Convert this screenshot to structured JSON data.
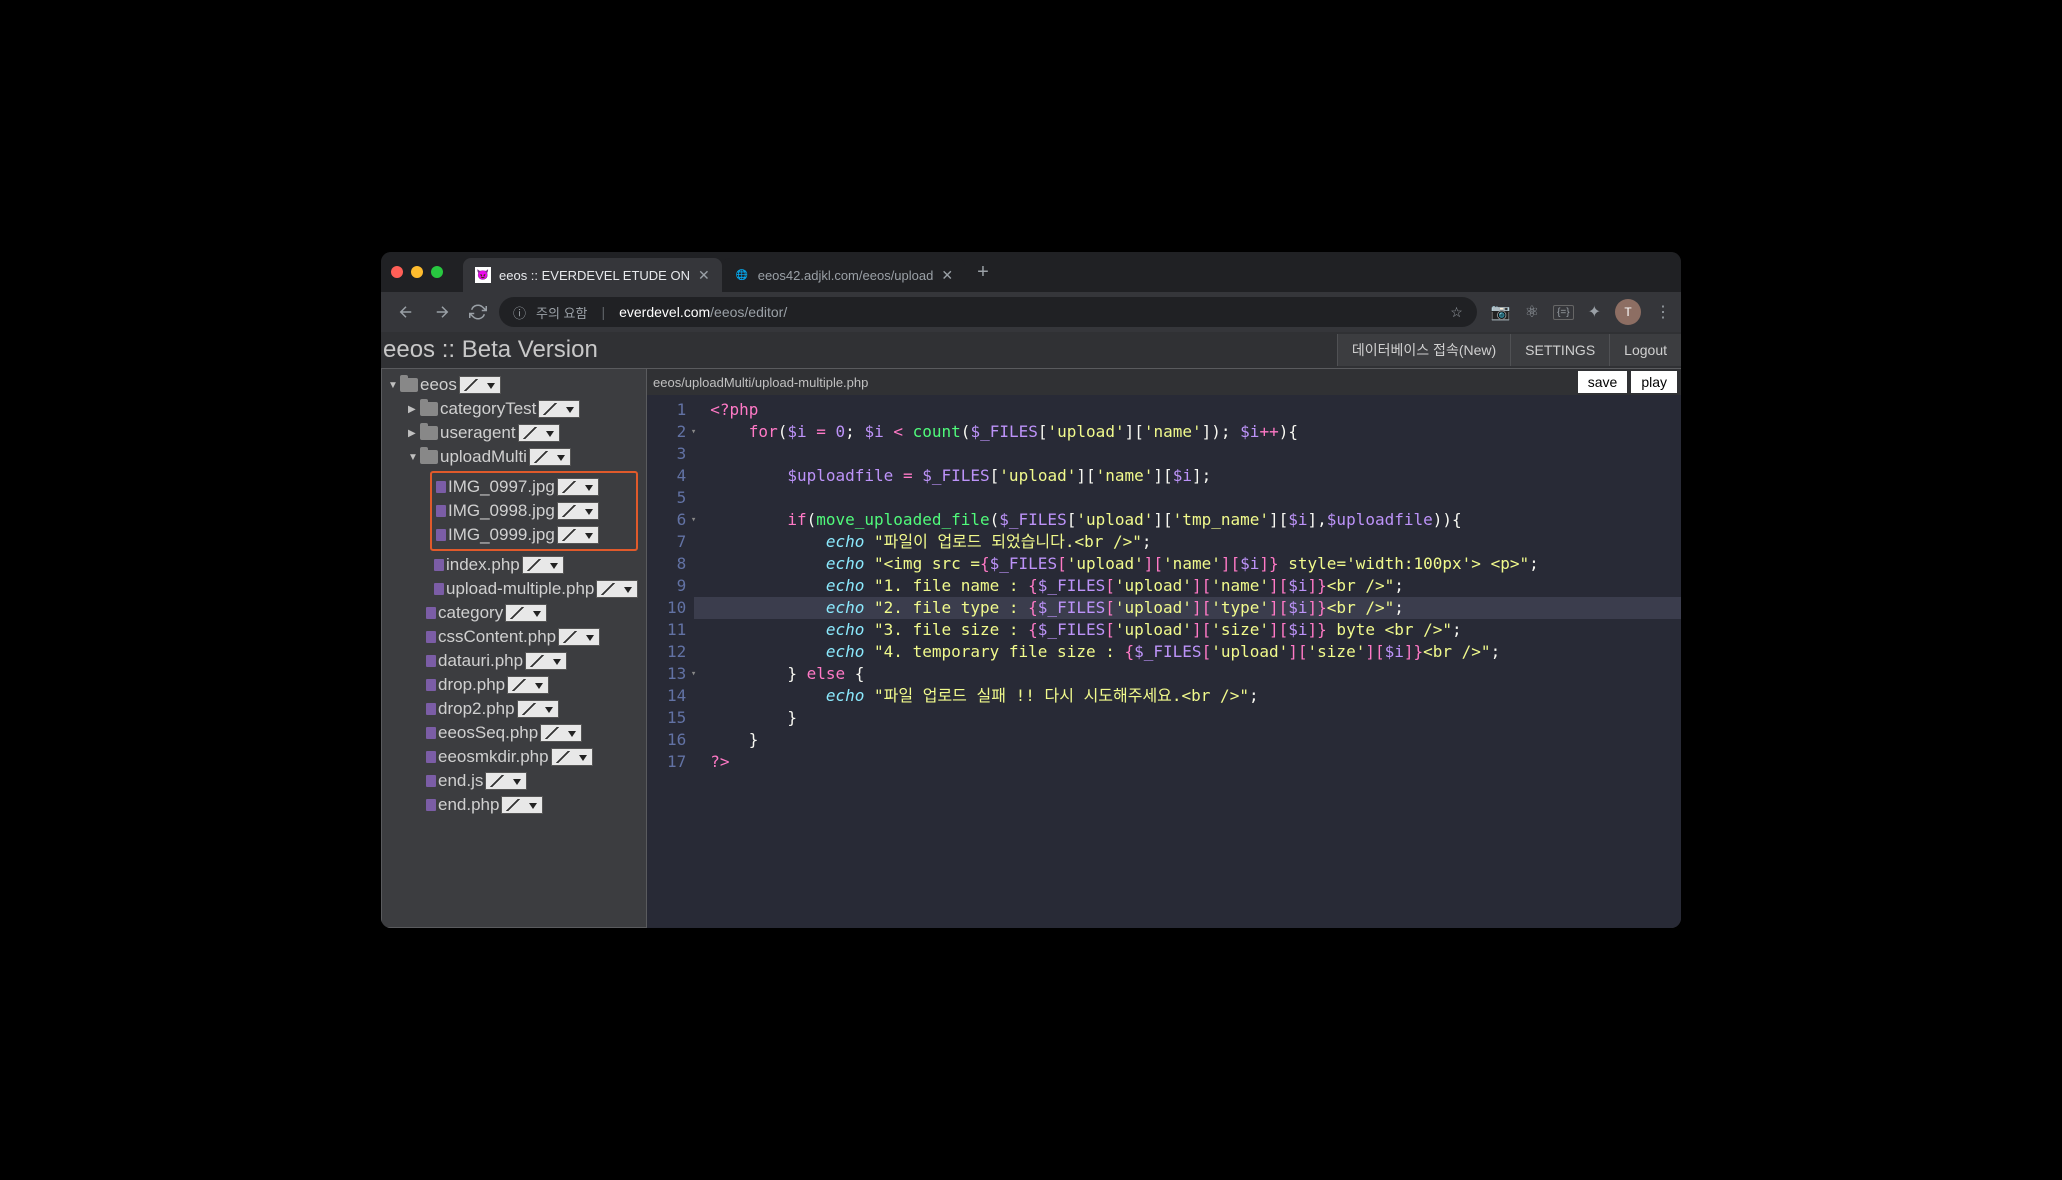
{
  "browser": {
    "tabs": [
      {
        "title": "eeos :: EVERDEVEL ETUDE ON",
        "favicon": "😈",
        "active": true
      },
      {
        "title": "eeos42.adjkl.com/eeos/upload",
        "favicon": "globe",
        "active": false
      }
    ],
    "url": {
      "warning": "주의 요함",
      "host": "everdevel.com",
      "path": "/eeos/editor/"
    },
    "avatar_letter": "T"
  },
  "app": {
    "title": "eeos :: Beta Version",
    "header_buttons": {
      "db": "데이터베이스 접속(New)",
      "settings": "SETTINGS",
      "logout": "Logout"
    },
    "breadcrumb": "eeos/uploadMulti/upload-multiple.php",
    "action_buttons": {
      "save": "save",
      "play": "play"
    }
  },
  "tree": {
    "root": {
      "name": "eeos",
      "arrow": "▼"
    },
    "folders": [
      {
        "name": "categoryTest",
        "arrow": "▶",
        "indent": 1
      },
      {
        "name": "useragent",
        "arrow": "▶",
        "indent": 1
      },
      {
        "name": "uploadMulti",
        "arrow": "▼",
        "indent": 1
      }
    ],
    "highlighted_files": [
      "IMG_0997.jpg",
      "IMG_0998.jpg",
      "IMG_0999.jpg"
    ],
    "upload_multi_files": [
      "index.php",
      "upload-multiple.php"
    ],
    "root_files": [
      "category",
      "cssContent.php",
      "datauri.php",
      "drop.php",
      "drop2.php",
      "eeosSeq.php",
      "eeosmkdir.php",
      "end.js",
      "end.php"
    ]
  },
  "code": {
    "lines": [
      {
        "n": 1,
        "fold": "",
        "tokens": [
          [
            "c-php",
            "<?php"
          ]
        ]
      },
      {
        "n": 2,
        "fold": "▾",
        "tokens": [
          [
            "",
            "    "
          ],
          [
            "c-kw",
            "for"
          ],
          [
            "c-punc",
            "("
          ],
          [
            "c-varn",
            "$i"
          ],
          [
            "c-punc",
            " "
          ],
          [
            "c-op",
            "="
          ],
          [
            "c-punc",
            " "
          ],
          [
            "c-num",
            "0"
          ],
          [
            "c-punc",
            "; "
          ],
          [
            "c-varn",
            "$i"
          ],
          [
            "c-punc",
            " "
          ],
          [
            "c-op",
            "<"
          ],
          [
            "c-punc",
            " "
          ],
          [
            "c-func",
            "count"
          ],
          [
            "c-punc",
            "("
          ],
          [
            "c-varn",
            "$_FILES"
          ],
          [
            "c-punc",
            "["
          ],
          [
            "c-str",
            "'upload'"
          ],
          [
            "c-punc",
            "]["
          ],
          [
            "c-str",
            "'name'"
          ],
          [
            "c-punc",
            "]); "
          ],
          [
            "c-varn",
            "$i"
          ],
          [
            "c-op",
            "++"
          ],
          [
            "c-punc",
            ")"
          ],
          [
            "c-punc",
            "{"
          ]
        ]
      },
      {
        "n": 3,
        "fold": "",
        "tokens": [
          [
            "",
            ""
          ]
        ]
      },
      {
        "n": 4,
        "fold": "",
        "tokens": [
          [
            "",
            "        "
          ],
          [
            "c-varn",
            "$uploadfile"
          ],
          [
            "c-punc",
            " "
          ],
          [
            "c-op",
            "="
          ],
          [
            "c-punc",
            " "
          ],
          [
            "c-varn",
            "$_FILES"
          ],
          [
            "c-punc",
            "["
          ],
          [
            "c-str",
            "'upload'"
          ],
          [
            "c-punc",
            "]["
          ],
          [
            "c-str",
            "'name'"
          ],
          [
            "c-punc",
            "]["
          ],
          [
            "c-varn",
            "$i"
          ],
          [
            "c-punc",
            "];"
          ]
        ]
      },
      {
        "n": 5,
        "fold": "",
        "tokens": [
          [
            "",
            ""
          ]
        ]
      },
      {
        "n": 6,
        "fold": "▾",
        "tokens": [
          [
            "",
            "        "
          ],
          [
            "c-kw",
            "if"
          ],
          [
            "c-punc",
            "("
          ],
          [
            "c-func",
            "move_uploaded_file"
          ],
          [
            "c-punc",
            "("
          ],
          [
            "c-varn",
            "$_FILES"
          ],
          [
            "c-punc",
            "["
          ],
          [
            "c-str",
            "'upload'"
          ],
          [
            "c-punc",
            "]["
          ],
          [
            "c-str",
            "'tmp_name'"
          ],
          [
            "c-punc",
            "]["
          ],
          [
            "c-varn",
            "$i"
          ],
          [
            "c-punc",
            "],"
          ],
          [
            "c-varn",
            "$uploadfile"
          ],
          [
            "c-punc",
            ")){"
          ]
        ]
      },
      {
        "n": 7,
        "fold": "",
        "tokens": [
          [
            "",
            "            "
          ],
          [
            "c-echo",
            "echo"
          ],
          [
            "c-punc",
            " "
          ],
          [
            "c-str",
            "\"파일이 업로드 되었습니다.<br />\""
          ],
          [
            "c-punc",
            ";"
          ]
        ]
      },
      {
        "n": 8,
        "fold": "",
        "tokens": [
          [
            "",
            "            "
          ],
          [
            "c-echo",
            "echo"
          ],
          [
            "c-punc",
            " "
          ],
          [
            "c-str",
            "\"<img src ="
          ],
          [
            "c-interp",
            "{"
          ],
          [
            "c-varn",
            "$_FILES"
          ],
          [
            "c-interp",
            "["
          ],
          [
            "c-str",
            "'upload'"
          ],
          [
            "c-interp",
            "]["
          ],
          [
            "c-str",
            "'name'"
          ],
          [
            "c-interp",
            "]["
          ],
          [
            "c-varn",
            "$i"
          ],
          [
            "c-interp",
            "]}"
          ],
          [
            "c-str",
            " style='width:100px'> <p>\""
          ],
          [
            "c-punc",
            ";"
          ]
        ]
      },
      {
        "n": 9,
        "fold": "",
        "tokens": [
          [
            "",
            "            "
          ],
          [
            "c-echo",
            "echo"
          ],
          [
            "c-punc",
            " "
          ],
          [
            "c-str",
            "\"1. file name : "
          ],
          [
            "c-interp",
            "{"
          ],
          [
            "c-varn",
            "$_FILES"
          ],
          [
            "c-interp",
            "["
          ],
          [
            "c-str",
            "'upload'"
          ],
          [
            "c-interp",
            "]["
          ],
          [
            "c-str",
            "'name'"
          ],
          [
            "c-interp",
            "]["
          ],
          [
            "c-varn",
            "$i"
          ],
          [
            "c-interp",
            "]}"
          ],
          [
            "c-str",
            "<br />\""
          ],
          [
            "c-punc",
            ";"
          ]
        ]
      },
      {
        "n": 10,
        "fold": "",
        "hl": true,
        "tokens": [
          [
            "",
            "            "
          ],
          [
            "c-echo",
            "echo"
          ],
          [
            "c-punc",
            " "
          ],
          [
            "c-str",
            "\"2. file type : "
          ],
          [
            "c-interp",
            "{"
          ],
          [
            "c-varn",
            "$_FILES"
          ],
          [
            "c-interp",
            "["
          ],
          [
            "c-str",
            "'upload'"
          ],
          [
            "c-interp",
            "]["
          ],
          [
            "c-str",
            "'type'"
          ],
          [
            "c-interp",
            "]["
          ],
          [
            "c-varn",
            "$i"
          ],
          [
            "c-interp",
            "]}"
          ],
          [
            "c-str",
            "<br />\""
          ],
          [
            "c-punc",
            ";"
          ]
        ]
      },
      {
        "n": 11,
        "fold": "",
        "tokens": [
          [
            "",
            "            "
          ],
          [
            "c-echo",
            "echo"
          ],
          [
            "c-punc",
            " "
          ],
          [
            "c-str",
            "\"3. file size : "
          ],
          [
            "c-interp",
            "{"
          ],
          [
            "c-varn",
            "$_FILES"
          ],
          [
            "c-interp",
            "["
          ],
          [
            "c-str",
            "'upload'"
          ],
          [
            "c-interp",
            "]["
          ],
          [
            "c-str",
            "'size'"
          ],
          [
            "c-interp",
            "]["
          ],
          [
            "c-varn",
            "$i"
          ],
          [
            "c-interp",
            "]}"
          ],
          [
            "c-str",
            " byte <br />\""
          ],
          [
            "c-punc",
            ";"
          ]
        ]
      },
      {
        "n": 12,
        "fold": "",
        "tokens": [
          [
            "",
            "            "
          ],
          [
            "c-echo",
            "echo"
          ],
          [
            "c-punc",
            " "
          ],
          [
            "c-str",
            "\"4. temporary file size : "
          ],
          [
            "c-interp",
            "{"
          ],
          [
            "c-varn",
            "$_FILES"
          ],
          [
            "c-interp",
            "["
          ],
          [
            "c-str",
            "'upload'"
          ],
          [
            "c-interp",
            "]["
          ],
          [
            "c-str",
            "'size'"
          ],
          [
            "c-interp",
            "]["
          ],
          [
            "c-varn",
            "$i"
          ],
          [
            "c-interp",
            "]}"
          ],
          [
            "c-str",
            "<br />\""
          ],
          [
            "c-punc",
            ";"
          ]
        ]
      },
      {
        "n": 13,
        "fold": "▾",
        "tokens": [
          [
            "",
            "        "
          ],
          [
            "c-punc",
            "} "
          ],
          [
            "c-kw",
            "else"
          ],
          [
            "c-punc",
            " {"
          ]
        ]
      },
      {
        "n": 14,
        "fold": "",
        "tokens": [
          [
            "",
            "            "
          ],
          [
            "c-echo",
            "echo"
          ],
          [
            "c-punc",
            " "
          ],
          [
            "c-str",
            "\"파일 업로드 실패 !! 다시 시도해주세요.<br />\""
          ],
          [
            "c-punc",
            ";"
          ]
        ]
      },
      {
        "n": 15,
        "fold": "",
        "tokens": [
          [
            "",
            "        "
          ],
          [
            "c-punc",
            "}"
          ]
        ]
      },
      {
        "n": 16,
        "fold": "",
        "tokens": [
          [
            "",
            "    "
          ],
          [
            "c-punc",
            "}"
          ]
        ]
      },
      {
        "n": 17,
        "fold": "",
        "tokens": [
          [
            "c-php",
            "?>"
          ]
        ]
      }
    ]
  }
}
